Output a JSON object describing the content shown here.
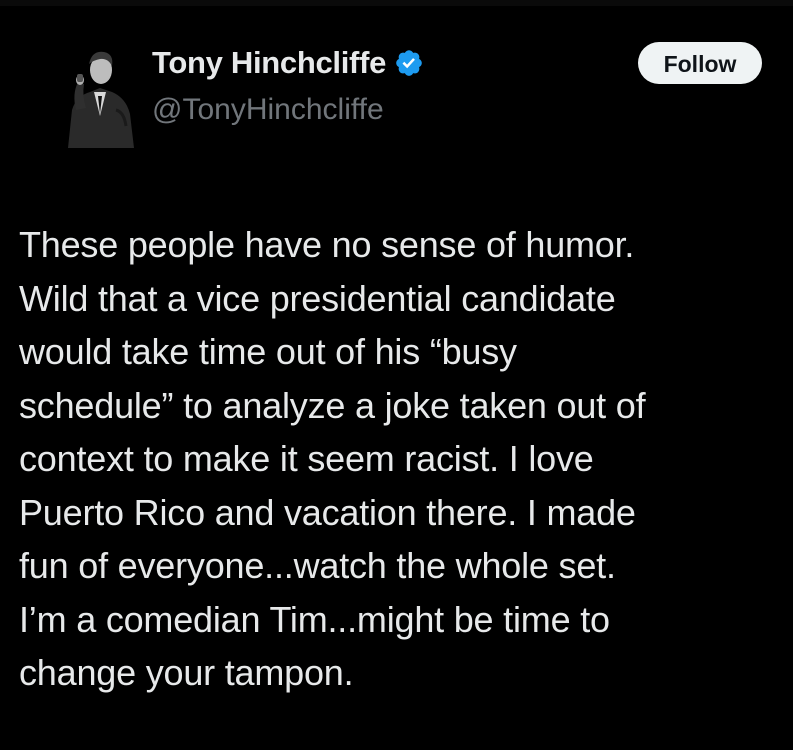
{
  "author": {
    "display_name": "Tony Hinchcliffe",
    "handle": "@TonyHinchcliffe",
    "verified": true,
    "verified_color": "#1d9bf0"
  },
  "actions": {
    "follow_label": "Follow"
  },
  "tweet": {
    "lines": [
      "These people have no sense of humor.",
      "Wild that a vice presidential candidate",
      "would take time out of his “busy",
      "schedule” to analyze a joke taken out of",
      "context to make it seem racist. I love",
      "Puerto Rico and vacation there. I made",
      "fun of everyone...watch the whole set.",
      "I’m a comedian Tim...might be time to",
      "change your tampon."
    ]
  },
  "colors": {
    "background": "#000000",
    "primary_text": "#e7e9ea",
    "secondary_text": "#71767b",
    "button_bg": "#eff3f4",
    "button_text": "#0f1419"
  }
}
